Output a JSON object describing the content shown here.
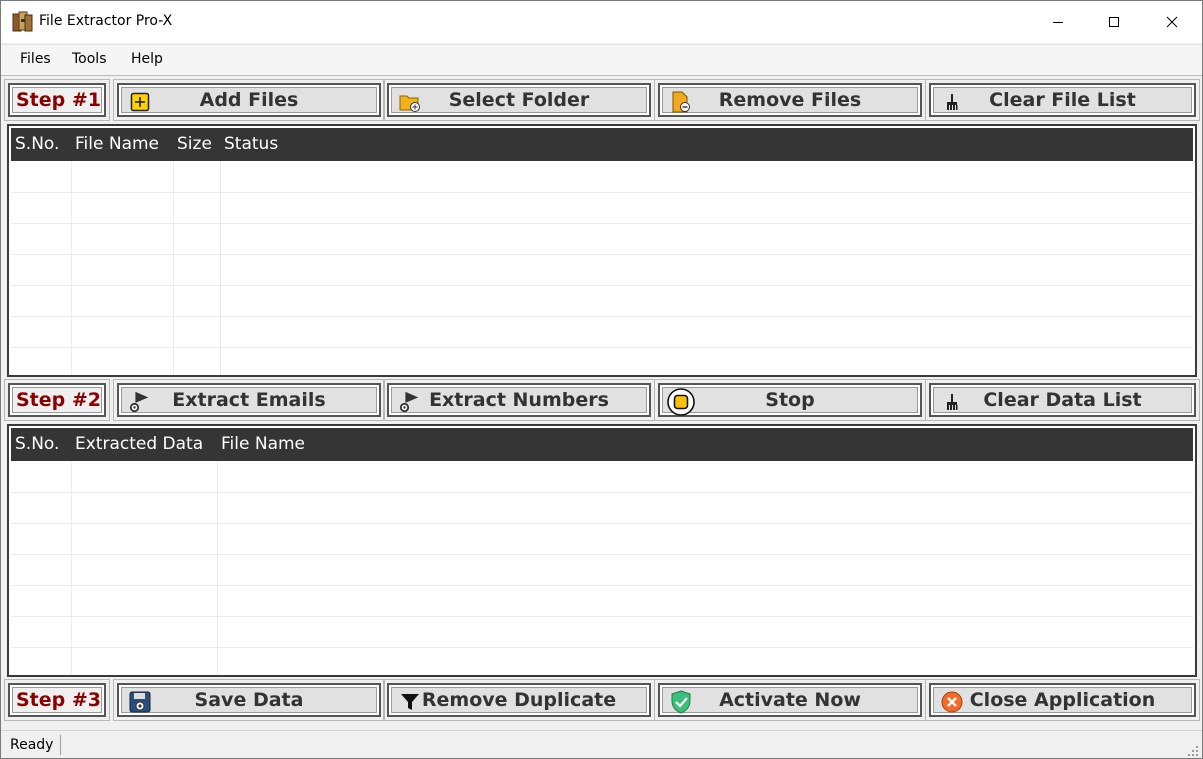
{
  "window": {
    "title": "File Extractor Pro-X"
  },
  "menu": [
    "Files",
    "Tools",
    "Help"
  ],
  "step1": {
    "label": "Step #1",
    "buttons": [
      "Add Files",
      "Select Folder",
      "Remove Files",
      "Clear File List"
    ]
  },
  "files_table": {
    "columns": [
      "S.No.",
      "File Name",
      "Size",
      "Status"
    ],
    "rows": []
  },
  "step2": {
    "label": "Step #2",
    "buttons": [
      "Extract Emails",
      "Extract Numbers",
      "Stop",
      "Clear Data List"
    ]
  },
  "data_table": {
    "columns": [
      "S.No.",
      "Extracted Data",
      "File Name"
    ],
    "rows": []
  },
  "step3": {
    "label": "Step #3",
    "buttons": [
      "Save Data",
      "Remove Duplicate",
      "Activate Now",
      "Close Application"
    ]
  },
  "status": {
    "text": "Ready"
  },
  "icons": {
    "app": "archive-icon",
    "add_files": "plus-square-icon",
    "select_folder": "folder-add-icon",
    "remove_files": "file-remove-icon",
    "clear_list": "broom-icon",
    "extract": "funnel-gear-icon",
    "stop": "stop-icon",
    "save": "floppy-icon",
    "remove_duplicate": "filter-icon",
    "activate": "shield-check-icon",
    "close": "close-circle-icon"
  },
  "colors": {
    "step_label": "#8b0000",
    "header_bg": "#353535",
    "button_bg": "#e1e1e1"
  }
}
